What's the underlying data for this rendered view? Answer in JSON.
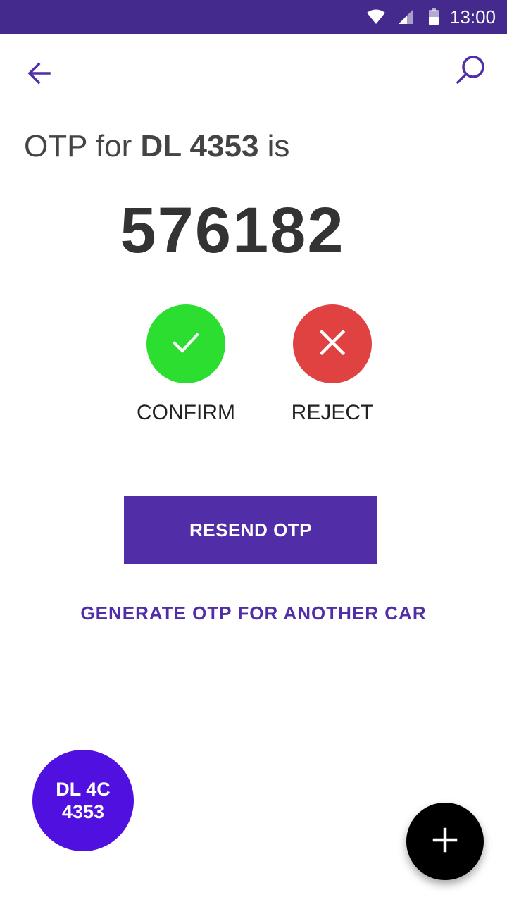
{
  "status_bar": {
    "time": "13:00",
    "background_color": "#432a8c",
    "icons": [
      "wifi-icon",
      "signal-icon",
      "battery-icon"
    ]
  },
  "app_bar": {
    "back_icon": "arrow-left-icon",
    "search_icon": "search-icon",
    "icon_color": "#512da8"
  },
  "otp": {
    "prefix": "OTP for ",
    "vehicle": "DL 4353",
    "suffix": " is",
    "code": "576182"
  },
  "actions": {
    "confirm": {
      "label": "CONFIRM",
      "icon": "check-icon",
      "color": "#2bde2f"
    },
    "reject": {
      "label": "REJECT",
      "icon": "close-icon",
      "color": "#e04242"
    }
  },
  "resend_button": {
    "label": "RESEND OTP",
    "color": "#512da8"
  },
  "generate_link": {
    "label": "GENERATE OTP FOR ANOTHER CAR",
    "color": "#512da8"
  },
  "car_badge": {
    "line1": "DL 4C",
    "line2": "4353",
    "color": "#5010e0"
  },
  "fab": {
    "icon": "plus-icon",
    "color": "#000000"
  }
}
